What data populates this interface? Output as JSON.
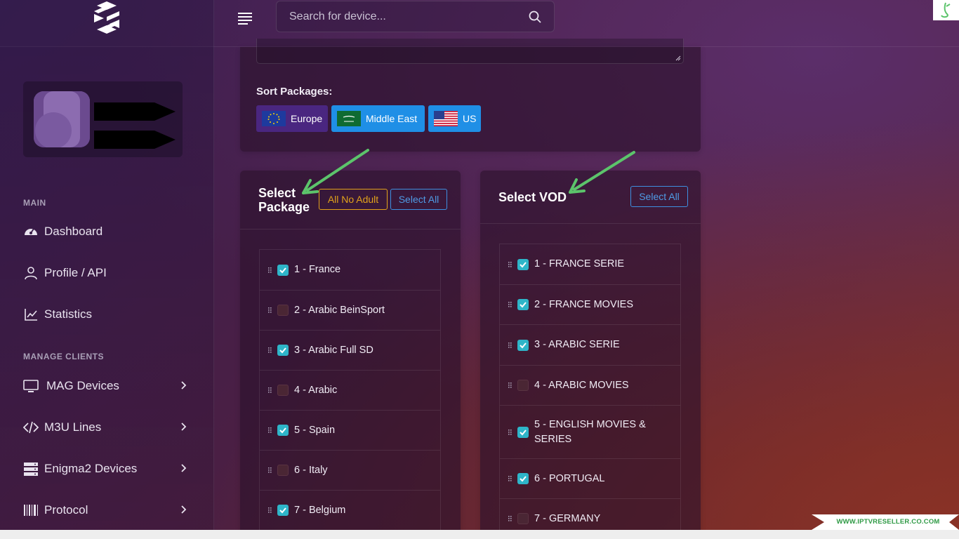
{
  "topbar": {
    "search_placeholder": "Search for device..."
  },
  "sidebar": {
    "sections": [
      {
        "title": "MAIN"
      },
      {
        "title": "MANAGE CLIENTS"
      }
    ],
    "main_items": [
      {
        "label": "Dashboard",
        "icon": "speedometer-icon"
      },
      {
        "label": "Profile / API",
        "icon": "user-icon"
      },
      {
        "label": "Statistics",
        "icon": "chart-line-icon"
      }
    ],
    "client_items": [
      {
        "label": "MAG Devices",
        "icon": "monitor-icon"
      },
      {
        "label": "M3U Lines",
        "icon": "code-icon"
      },
      {
        "label": "Enigma2 Devices",
        "icon": "server-icon"
      },
      {
        "label": "Protocol",
        "icon": "barcode-icon"
      }
    ]
  },
  "sort": {
    "title": "Sort Packages:",
    "buttons": [
      {
        "label": "Europe",
        "icon": "eu-flag-icon",
        "color": "#4a2680"
      },
      {
        "label": "Middle East",
        "icon": "saudi-flag-icon",
        "color": "#1f8fe6"
      },
      {
        "label": "US",
        "icon": "us-flag-icon",
        "color": "#1f8fe6"
      }
    ]
  },
  "packages": {
    "title_line1": "Select",
    "title_line2": "Package",
    "no_adult_label": "All No Adult",
    "select_all_label": "Select All",
    "items": [
      {
        "label": "1 - France",
        "checked": true
      },
      {
        "label": "2 - Arabic BeinSport",
        "checked": false
      },
      {
        "label": "3 - Arabic Full SD",
        "checked": true
      },
      {
        "label": "4 - Arabic",
        "checked": false
      },
      {
        "label": "5 - Spain",
        "checked": true
      },
      {
        "label": "6 - Italy",
        "checked": false
      },
      {
        "label": "7 - Belgium",
        "checked": true
      }
    ]
  },
  "vod": {
    "title": "Select VOD",
    "select_all_label": "Select All",
    "items": [
      {
        "label": "1 - FRANCE SERIE",
        "checked": true
      },
      {
        "label": "2 - FRANCE MOVIES",
        "checked": true
      },
      {
        "label": "3 - ARABIC SERIE",
        "checked": true
      },
      {
        "label": "4 - ARABIC MOVIES",
        "checked": false
      },
      {
        "label": "5 - ENGLISH MOVIES &",
        "label_line2": "SERIES",
        "checked": true
      },
      {
        "label": "6 - PORTUGAL",
        "checked": true
      },
      {
        "label": "7 - GERMANY",
        "checked": false
      }
    ]
  },
  "watermark": {
    "text": "WWW.IPTVRESELLER.CO.COM"
  },
  "colors": {
    "accent_teal": "#2eb5c9",
    "warning_outline": "#e2a21b",
    "primary_outline": "#3e8fe0",
    "annotation_arrow": "#5cc46b"
  }
}
